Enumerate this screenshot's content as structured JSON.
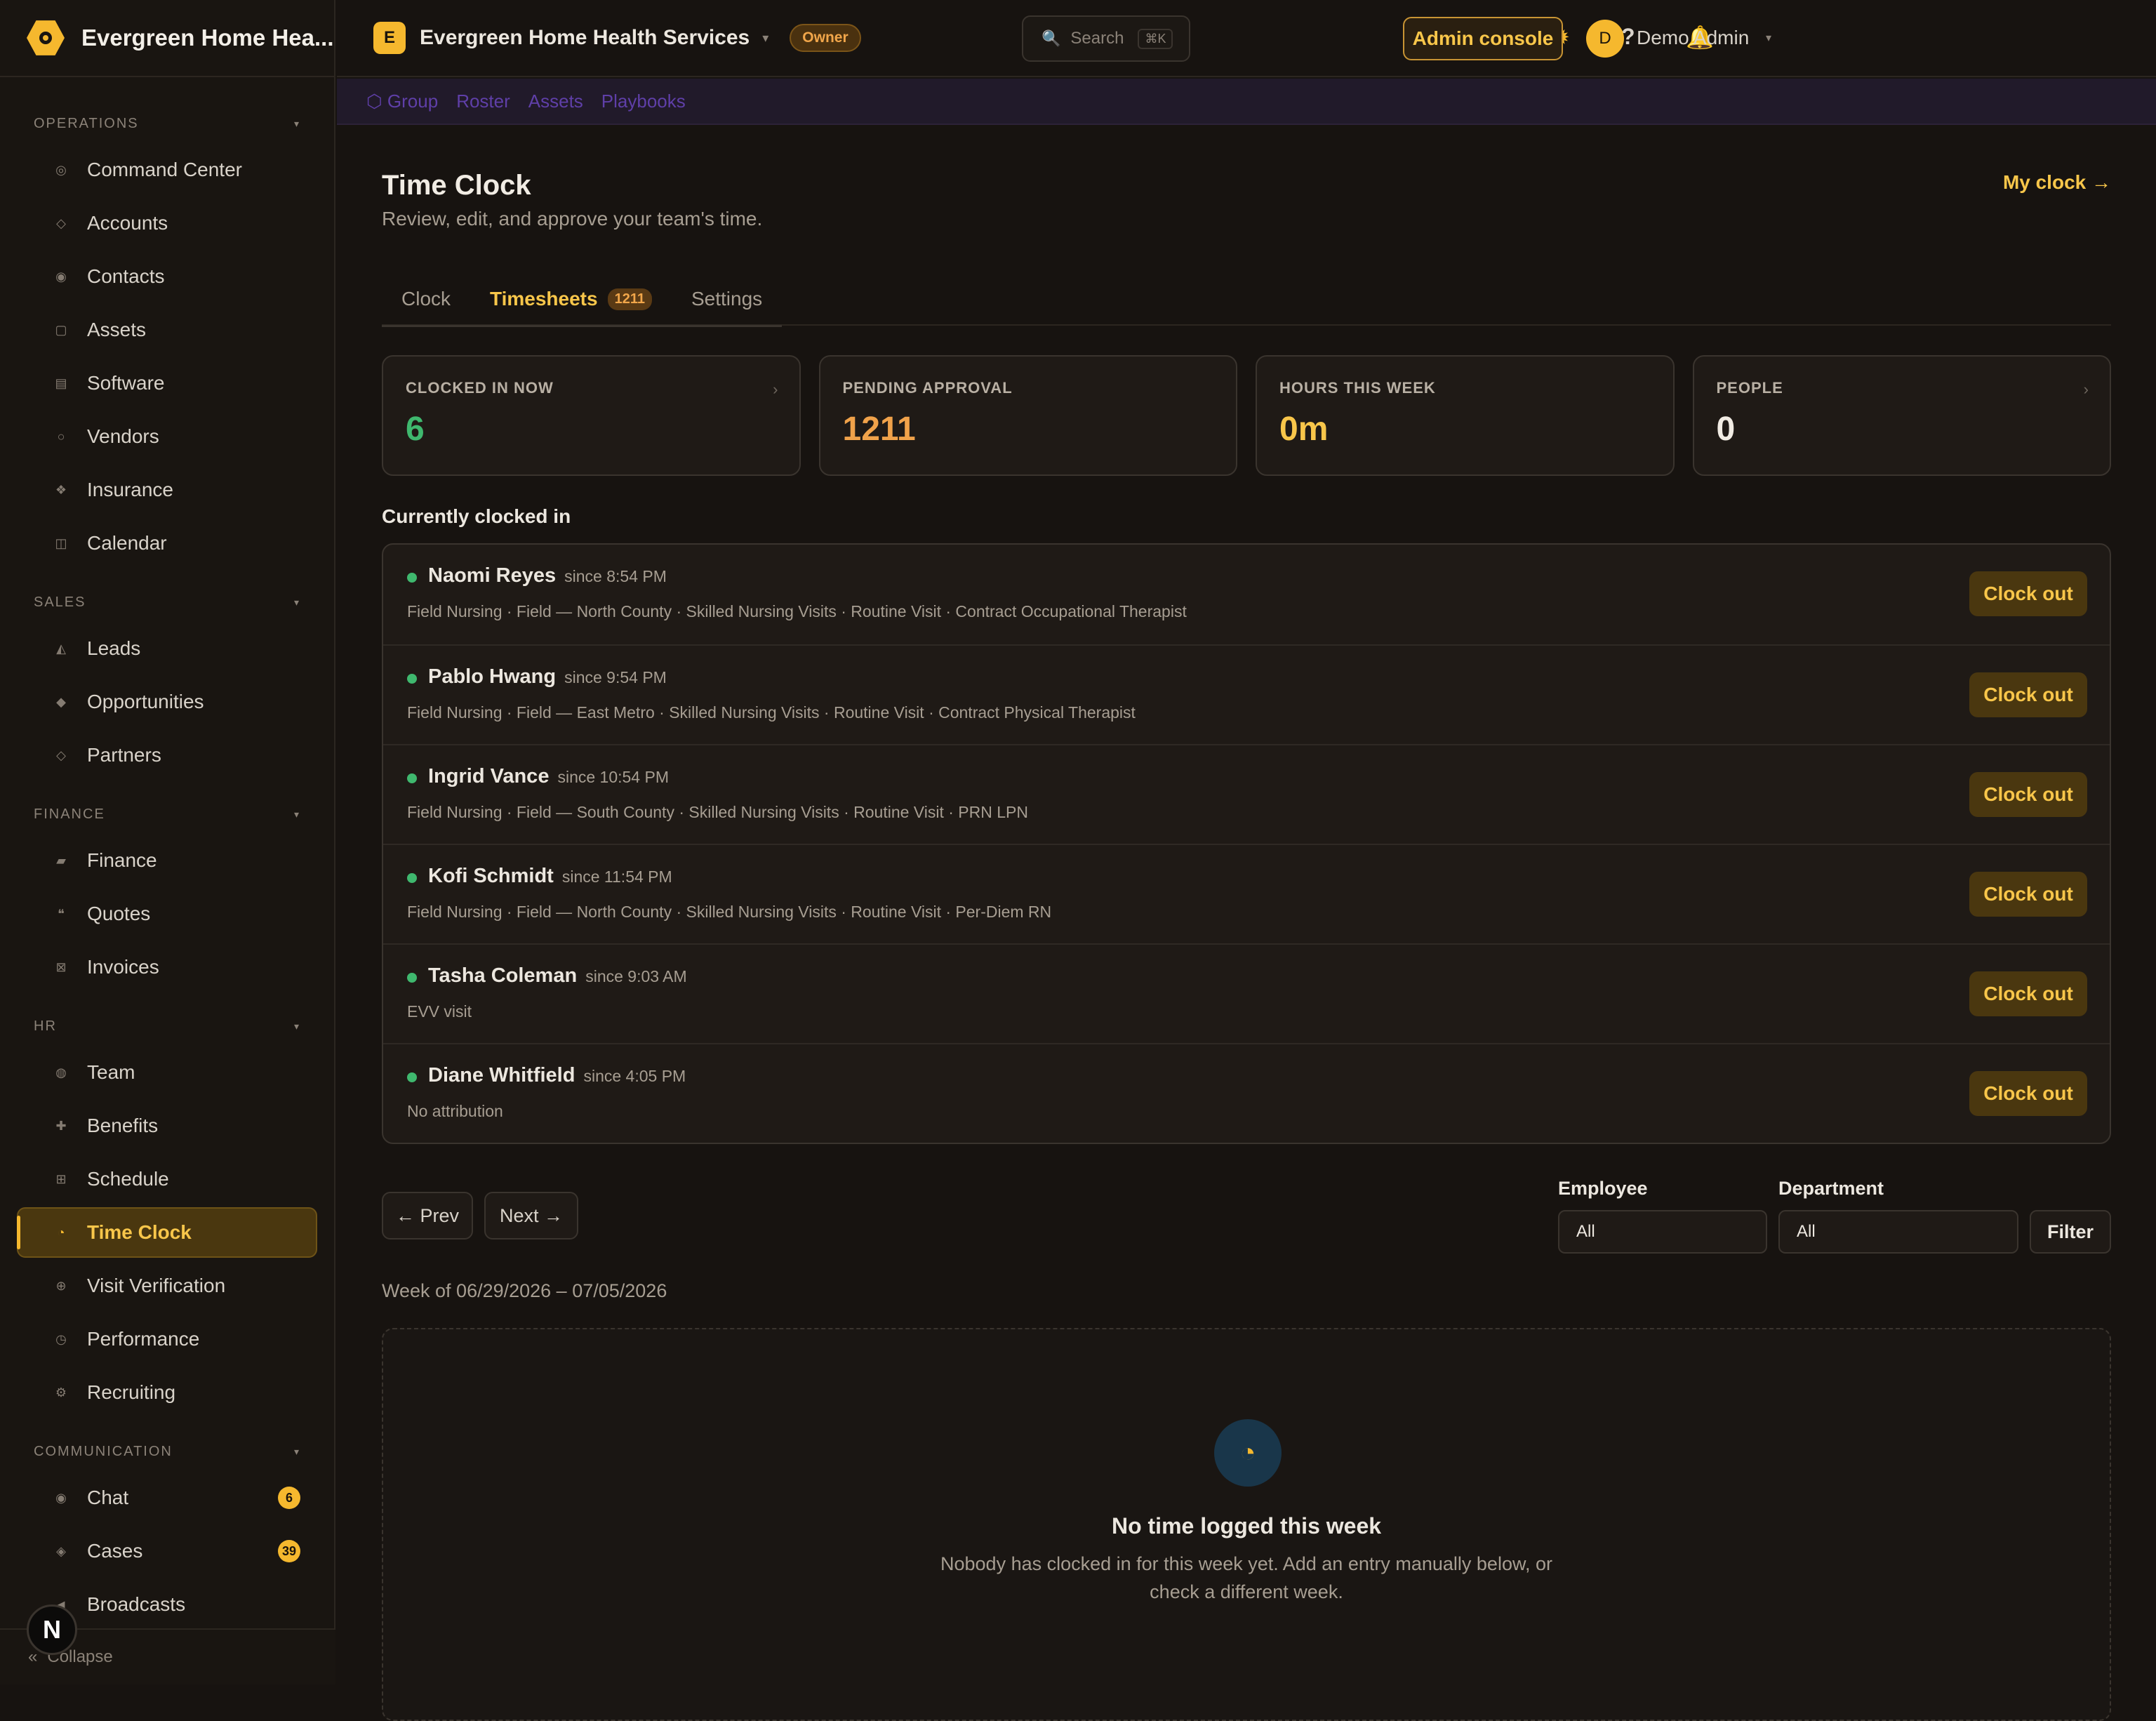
{
  "brand": {
    "name": "Evergreen Home Hea..."
  },
  "sidebar": {
    "sections": [
      {
        "title": "OPERATIONS",
        "items": [
          {
            "label": "Command Center",
            "icon": "target-icon"
          },
          {
            "label": "Accounts",
            "icon": "diamond-icon"
          },
          {
            "label": "Contacts",
            "icon": "user-circle-icon"
          },
          {
            "label": "Assets",
            "icon": "box-icon"
          },
          {
            "label": "Software",
            "icon": "stack-icon"
          },
          {
            "label": "Vendors",
            "icon": "circle-icon"
          },
          {
            "label": "Insurance",
            "icon": "shield-icon"
          },
          {
            "label": "Calendar",
            "icon": "calendar-icon"
          }
        ]
      },
      {
        "title": "SALES",
        "items": [
          {
            "label": "Leads",
            "icon": "triangle-icon"
          },
          {
            "label": "Opportunities",
            "icon": "diamond-filled-icon"
          },
          {
            "label": "Partners",
            "icon": "diamond-icon"
          }
        ]
      },
      {
        "title": "FINANCE",
        "items": [
          {
            "label": "Finance",
            "icon": "card-icon"
          },
          {
            "label": "Quotes",
            "icon": "quote-icon"
          },
          {
            "label": "Invoices",
            "icon": "invoice-icon"
          }
        ]
      },
      {
        "title": "HR",
        "items": [
          {
            "label": "Team",
            "icon": "users-icon"
          },
          {
            "label": "Benefits",
            "icon": "plus-icon"
          },
          {
            "label": "Schedule",
            "icon": "grid-icon"
          },
          {
            "label": "Time Clock",
            "icon": "clock-icon",
            "active": true
          },
          {
            "label": "Visit Verification",
            "icon": "globe-icon"
          },
          {
            "label": "Performance",
            "icon": "gauge-icon"
          },
          {
            "label": "Recruiting",
            "icon": "gear-icon"
          }
        ]
      },
      {
        "title": "COMMUNICATION",
        "items": [
          {
            "label": "Chat",
            "icon": "chat-icon",
            "count": "6"
          },
          {
            "label": "Cases",
            "icon": "case-icon",
            "count": "39"
          },
          {
            "label": "Broadcasts",
            "icon": "megaphone-icon"
          }
        ]
      }
    ],
    "collapse": "Collapse",
    "floating_badge": "N"
  },
  "topbar": {
    "org_initial": "E",
    "org_name": "Evergreen Home Health Services",
    "role": "Owner",
    "search_label": "Search",
    "search_kbd": "⌘K",
    "admin_console": "Admin console",
    "user_initial": "D",
    "user_name": "Demo Admin"
  },
  "subnav": {
    "items": [
      "⬡ Group",
      "Roster",
      "Assets",
      "Playbooks"
    ]
  },
  "page": {
    "title": "Time Clock",
    "subtitle": "Review, edit, and approve your team's time.",
    "my_clock": "My clock →",
    "tabs": [
      {
        "label": "Clock"
      },
      {
        "label": "Timesheets",
        "badge": "1211",
        "active": true
      },
      {
        "label": "Settings"
      }
    ]
  },
  "stats": [
    {
      "label": "CLOCKED IN NOW",
      "value": "6",
      "color": "#3fb86e"
    },
    {
      "label": "PENDING APPROVAL",
      "value": "1211",
      "color": "#f0a24a"
    },
    {
      "label": "HOURS THIS WEEK",
      "value": "0m",
      "color": "#f8c64a"
    },
    {
      "label": "PEOPLE",
      "value": "0",
      "color": "#f1ece4"
    }
  ],
  "clocked_in": {
    "heading": "Currently clocked in",
    "button_label": "Clock out",
    "rows": [
      {
        "name": "Naomi Reyes",
        "since": "since 8:54 PM",
        "meta": "Field Nursing · Field — North County · Skilled Nursing Visits · Routine Visit · Contract Occupational Therapist"
      },
      {
        "name": "Pablo Hwang",
        "since": "since 9:54 PM",
        "meta": "Field Nursing · Field — East Metro · Skilled Nursing Visits · Routine Visit · Contract Physical Therapist"
      },
      {
        "name": "Ingrid Vance",
        "since": "since 10:54 PM",
        "meta": "Field Nursing · Field — South County · Skilled Nursing Visits · Routine Visit · PRN LPN"
      },
      {
        "name": "Kofi Schmidt",
        "since": "since 11:54 PM",
        "meta": "Field Nursing · Field — North County · Skilled Nursing Visits · Routine Visit · Per-Diem RN"
      },
      {
        "name": "Tasha Coleman",
        "since": "since 9:03 AM",
        "meta": "EVV visit"
      },
      {
        "name": "Diane Whitfield",
        "since": "since 4:05 PM",
        "meta": "No attribution"
      }
    ]
  },
  "pager": {
    "prev": "← Prev",
    "next": "Next →"
  },
  "filters": {
    "employee_label": "Employee",
    "employee_value": "All",
    "department_label": "Department",
    "department_value": "All",
    "button": "Filter"
  },
  "week_label": "Week of 06/29/2026 – 07/05/2026",
  "empty_state": {
    "title": "No time logged this week",
    "text": "Nobody has clocked in for this week yet. Add an entry manually below, or check a different week."
  }
}
